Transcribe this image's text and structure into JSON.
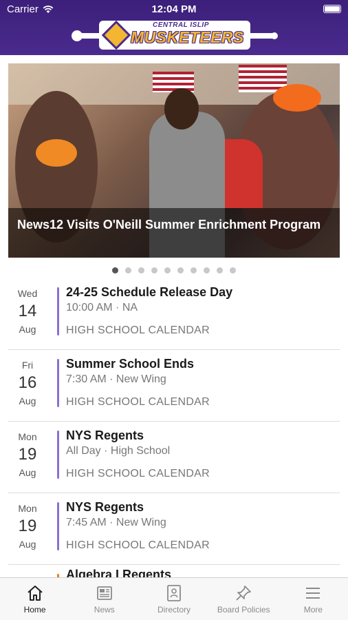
{
  "status_bar": {
    "carrier": "Carrier",
    "time": "12:04 PM"
  },
  "header": {
    "logo_top_text": "CENTRAL ISLIP",
    "logo_main_text": "MUSKETEERS",
    "colors": {
      "primary": "#4a2b8e",
      "gold": "#f2b632"
    }
  },
  "hero": {
    "title": "News12 Visits O'Neill Summer Enrichment Program",
    "slide_count": 10,
    "active_slide": 1
  },
  "events": [
    {
      "dow": "Wed",
      "day": "14",
      "month": "Aug",
      "title": "24-25 Schedule Release Day",
      "meta": "10:00 AM · NA",
      "calendar": "HIGH SCHOOL CALENDAR",
      "accent": "#8a6fd3"
    },
    {
      "dow": "Fri",
      "day": "16",
      "month": "Aug",
      "title": "Summer School Ends",
      "meta": "7:30 AM · New Wing",
      "calendar": "HIGH SCHOOL CALENDAR",
      "accent": "#8a6fd3"
    },
    {
      "dow": "Mon",
      "day": "19",
      "month": "Aug",
      "title": "NYS Regents",
      "meta": "All Day · High School",
      "calendar": "HIGH SCHOOL CALENDAR",
      "accent": "#8a6fd3"
    },
    {
      "dow": "Mon",
      "day": "19",
      "month": "Aug",
      "title": "NYS Regents",
      "meta": "7:45 AM · New Wing",
      "calendar": "HIGH SCHOOL CALENDAR",
      "accent": "#8a6fd3"
    },
    {
      "dow": "",
      "day": "",
      "month": "",
      "title": "Algebra I Regents",
      "meta": "",
      "calendar": "",
      "accent": "#e67e22"
    }
  ],
  "tabbar": {
    "items": [
      {
        "label": "Home",
        "icon": "home-icon",
        "active": true
      },
      {
        "label": "News",
        "icon": "newspaper-icon",
        "active": false
      },
      {
        "label": "Directory",
        "icon": "directory-icon",
        "active": false
      },
      {
        "label": "Board Policies",
        "icon": "pin-icon",
        "active": false
      },
      {
        "label": "More",
        "icon": "menu-icon",
        "active": false
      }
    ]
  }
}
